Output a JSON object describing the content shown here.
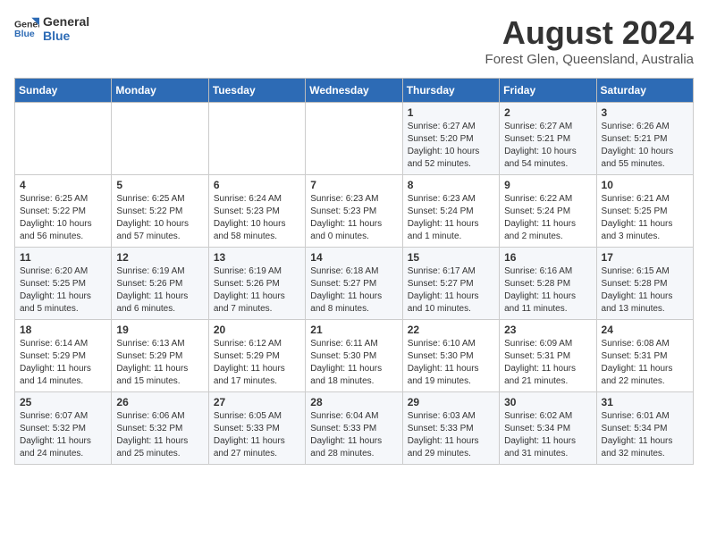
{
  "header": {
    "logo_line1": "General",
    "logo_line2": "Blue",
    "month": "August 2024",
    "location": "Forest Glen, Queensland, Australia"
  },
  "weekdays": [
    "Sunday",
    "Monday",
    "Tuesday",
    "Wednesday",
    "Thursday",
    "Friday",
    "Saturday"
  ],
  "weeks": [
    [
      {
        "day": "",
        "info": ""
      },
      {
        "day": "",
        "info": ""
      },
      {
        "day": "",
        "info": ""
      },
      {
        "day": "",
        "info": ""
      },
      {
        "day": "1",
        "info": "Sunrise: 6:27 AM\nSunset: 5:20 PM\nDaylight: 10 hours\nand 52 minutes."
      },
      {
        "day": "2",
        "info": "Sunrise: 6:27 AM\nSunset: 5:21 PM\nDaylight: 10 hours\nand 54 minutes."
      },
      {
        "day": "3",
        "info": "Sunrise: 6:26 AM\nSunset: 5:21 PM\nDaylight: 10 hours\nand 55 minutes."
      }
    ],
    [
      {
        "day": "4",
        "info": "Sunrise: 6:25 AM\nSunset: 5:22 PM\nDaylight: 10 hours\nand 56 minutes."
      },
      {
        "day": "5",
        "info": "Sunrise: 6:25 AM\nSunset: 5:22 PM\nDaylight: 10 hours\nand 57 minutes."
      },
      {
        "day": "6",
        "info": "Sunrise: 6:24 AM\nSunset: 5:23 PM\nDaylight: 10 hours\nand 58 minutes."
      },
      {
        "day": "7",
        "info": "Sunrise: 6:23 AM\nSunset: 5:23 PM\nDaylight: 11 hours\nand 0 minutes."
      },
      {
        "day": "8",
        "info": "Sunrise: 6:23 AM\nSunset: 5:24 PM\nDaylight: 11 hours\nand 1 minute."
      },
      {
        "day": "9",
        "info": "Sunrise: 6:22 AM\nSunset: 5:24 PM\nDaylight: 11 hours\nand 2 minutes."
      },
      {
        "day": "10",
        "info": "Sunrise: 6:21 AM\nSunset: 5:25 PM\nDaylight: 11 hours\nand 3 minutes."
      }
    ],
    [
      {
        "day": "11",
        "info": "Sunrise: 6:20 AM\nSunset: 5:25 PM\nDaylight: 11 hours\nand 5 minutes."
      },
      {
        "day": "12",
        "info": "Sunrise: 6:19 AM\nSunset: 5:26 PM\nDaylight: 11 hours\nand 6 minutes."
      },
      {
        "day": "13",
        "info": "Sunrise: 6:19 AM\nSunset: 5:26 PM\nDaylight: 11 hours\nand 7 minutes."
      },
      {
        "day": "14",
        "info": "Sunrise: 6:18 AM\nSunset: 5:27 PM\nDaylight: 11 hours\nand 8 minutes."
      },
      {
        "day": "15",
        "info": "Sunrise: 6:17 AM\nSunset: 5:27 PM\nDaylight: 11 hours\nand 10 minutes."
      },
      {
        "day": "16",
        "info": "Sunrise: 6:16 AM\nSunset: 5:28 PM\nDaylight: 11 hours\nand 11 minutes."
      },
      {
        "day": "17",
        "info": "Sunrise: 6:15 AM\nSunset: 5:28 PM\nDaylight: 11 hours\nand 13 minutes."
      }
    ],
    [
      {
        "day": "18",
        "info": "Sunrise: 6:14 AM\nSunset: 5:29 PM\nDaylight: 11 hours\nand 14 minutes."
      },
      {
        "day": "19",
        "info": "Sunrise: 6:13 AM\nSunset: 5:29 PM\nDaylight: 11 hours\nand 15 minutes."
      },
      {
        "day": "20",
        "info": "Sunrise: 6:12 AM\nSunset: 5:29 PM\nDaylight: 11 hours\nand 17 minutes."
      },
      {
        "day": "21",
        "info": "Sunrise: 6:11 AM\nSunset: 5:30 PM\nDaylight: 11 hours\nand 18 minutes."
      },
      {
        "day": "22",
        "info": "Sunrise: 6:10 AM\nSunset: 5:30 PM\nDaylight: 11 hours\nand 19 minutes."
      },
      {
        "day": "23",
        "info": "Sunrise: 6:09 AM\nSunset: 5:31 PM\nDaylight: 11 hours\nand 21 minutes."
      },
      {
        "day": "24",
        "info": "Sunrise: 6:08 AM\nSunset: 5:31 PM\nDaylight: 11 hours\nand 22 minutes."
      }
    ],
    [
      {
        "day": "25",
        "info": "Sunrise: 6:07 AM\nSunset: 5:32 PM\nDaylight: 11 hours\nand 24 minutes."
      },
      {
        "day": "26",
        "info": "Sunrise: 6:06 AM\nSunset: 5:32 PM\nDaylight: 11 hours\nand 25 minutes."
      },
      {
        "day": "27",
        "info": "Sunrise: 6:05 AM\nSunset: 5:33 PM\nDaylight: 11 hours\nand 27 minutes."
      },
      {
        "day": "28",
        "info": "Sunrise: 6:04 AM\nSunset: 5:33 PM\nDaylight: 11 hours\nand 28 minutes."
      },
      {
        "day": "29",
        "info": "Sunrise: 6:03 AM\nSunset: 5:33 PM\nDaylight: 11 hours\nand 29 minutes."
      },
      {
        "day": "30",
        "info": "Sunrise: 6:02 AM\nSunset: 5:34 PM\nDaylight: 11 hours\nand 31 minutes."
      },
      {
        "day": "31",
        "info": "Sunrise: 6:01 AM\nSunset: 5:34 PM\nDaylight: 11 hours\nand 32 minutes."
      }
    ]
  ]
}
